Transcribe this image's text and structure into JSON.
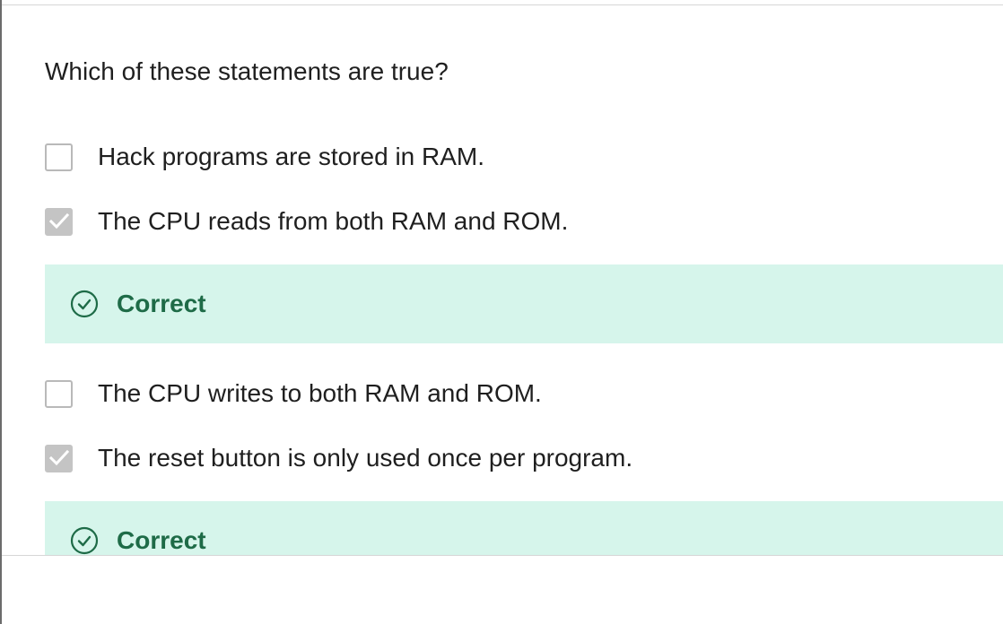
{
  "question": {
    "text": "Which of these statements are true?"
  },
  "options": [
    {
      "label": "Hack programs are stored in RAM.",
      "checked": false
    },
    {
      "label": "The CPU reads from both RAM and ROM.",
      "checked": true,
      "feedback": "Correct"
    },
    {
      "label": "The CPU writes to both RAM and ROM.",
      "checked": false
    },
    {
      "label": "The reset button is only used once per program.",
      "checked": true,
      "feedback": "Correct"
    }
  ],
  "icons": {
    "checkbox_check": "check-icon",
    "feedback": "check-circle-icon"
  },
  "colors": {
    "feedback_background": "#d6f5eb",
    "feedback_text": "#1e6b47",
    "checkbox_checked": "#c4c4c4",
    "checkbox_border": "#b9b9b9"
  }
}
